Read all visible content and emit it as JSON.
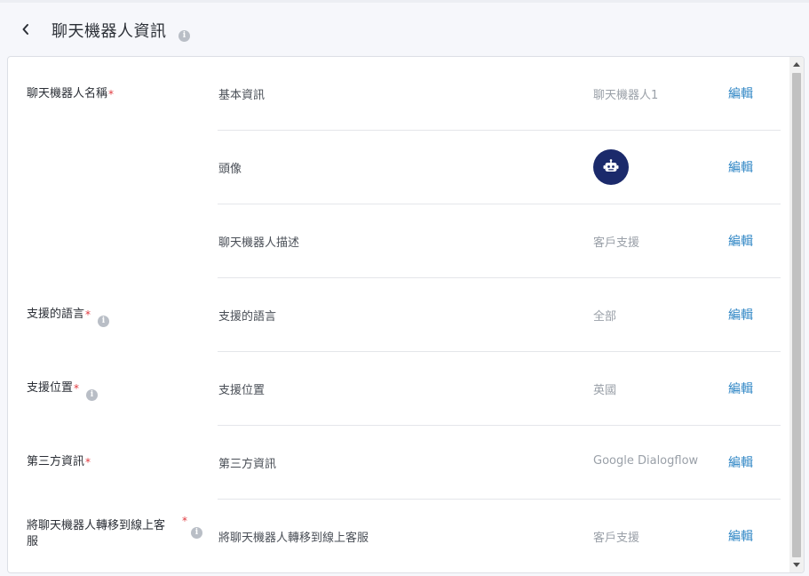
{
  "header": {
    "title": "聊天機器人資訊"
  },
  "groups": [
    {
      "label": "聊天機器人名稱",
      "required": "*",
      "has_info": false
    },
    {
      "label": "支援的語言",
      "required": "*",
      "has_info": true
    },
    {
      "label": "支援位置",
      "required": "*",
      "has_info": true
    },
    {
      "label": "第三方資訊",
      "required": "*",
      "has_info": false
    },
    {
      "label_line1": "將聊天機器人轉移到線上客",
      "label_line2": "服",
      "required": "*",
      "has_info": true
    }
  ],
  "rows": [
    {
      "label": "基本資訊",
      "value": "聊天機器人1",
      "edit": "編輯"
    },
    {
      "label": "頭像",
      "value_icon": "robot-icon",
      "edit": "編輯"
    },
    {
      "label": "聊天機器人描述",
      "value": "客戶支援",
      "edit": "編輯"
    },
    {
      "label": "支援的語言",
      "value": "全部",
      "edit": "編輯"
    },
    {
      "label": "支援位置",
      "value": "英國",
      "edit": "編輯"
    },
    {
      "label": "第三方資訊",
      "value": "Google Dialogflow",
      "edit": "編輯"
    },
    {
      "label": "將聊天機器人轉移到線上客服",
      "value": "客戶支援",
      "edit": "編輯"
    }
  ],
  "colors": {
    "accent": "#2f86c5",
    "required": "#e0393e",
    "avatar_bg": "#1b2a6b"
  }
}
